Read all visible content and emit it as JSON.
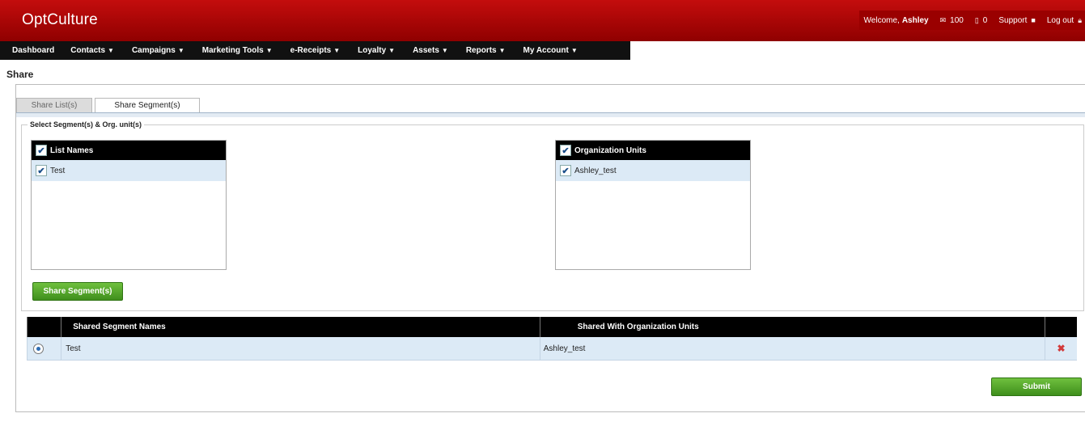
{
  "header": {
    "logo_opt": "Opt",
    "logo_culture": "Culture",
    "welcome": "Welcome, ",
    "username": "Ashley",
    "email_count": "100",
    "sms_count": "0",
    "support": "Support",
    "logout": "Log out"
  },
  "nav": {
    "items": [
      "Dashboard",
      "Contacts",
      "Campaigns",
      "Marketing Tools",
      "e-Receipts",
      "Loyalty",
      "Assets",
      "Reports",
      "My Account"
    ]
  },
  "page": {
    "title": "Share"
  },
  "tabs": {
    "share_lists": "Share List(s)",
    "share_segments": "Share Segment(s)"
  },
  "section": {
    "legend": "Select Segment(s) & Org. unit(s)"
  },
  "list_names": {
    "header": "List Names",
    "items": [
      "Test"
    ]
  },
  "org_units": {
    "header": "Organization Units",
    "items": [
      "Ashley_test"
    ]
  },
  "buttons": {
    "share_segments": "Share Segment(s)",
    "submit": "Submit"
  },
  "table": {
    "headers": [
      "",
      "Shared Segment Names",
      "Shared With Organization Units",
      ""
    ],
    "rows": [
      {
        "segment": "Test",
        "org_unit": "Ashley_test"
      }
    ]
  },
  "icons": {
    "email": "envelope-icon",
    "sms": "phone-icon",
    "support": "briefcase-icon",
    "logout": "lock-icon",
    "delete": "delete-x-icon",
    "check": "checkmark-icon"
  },
  "colors": {
    "header_red": "#b10000",
    "nav_black": "#111111",
    "button_green": "#52a62a",
    "row_blue": "#dceaf6"
  }
}
